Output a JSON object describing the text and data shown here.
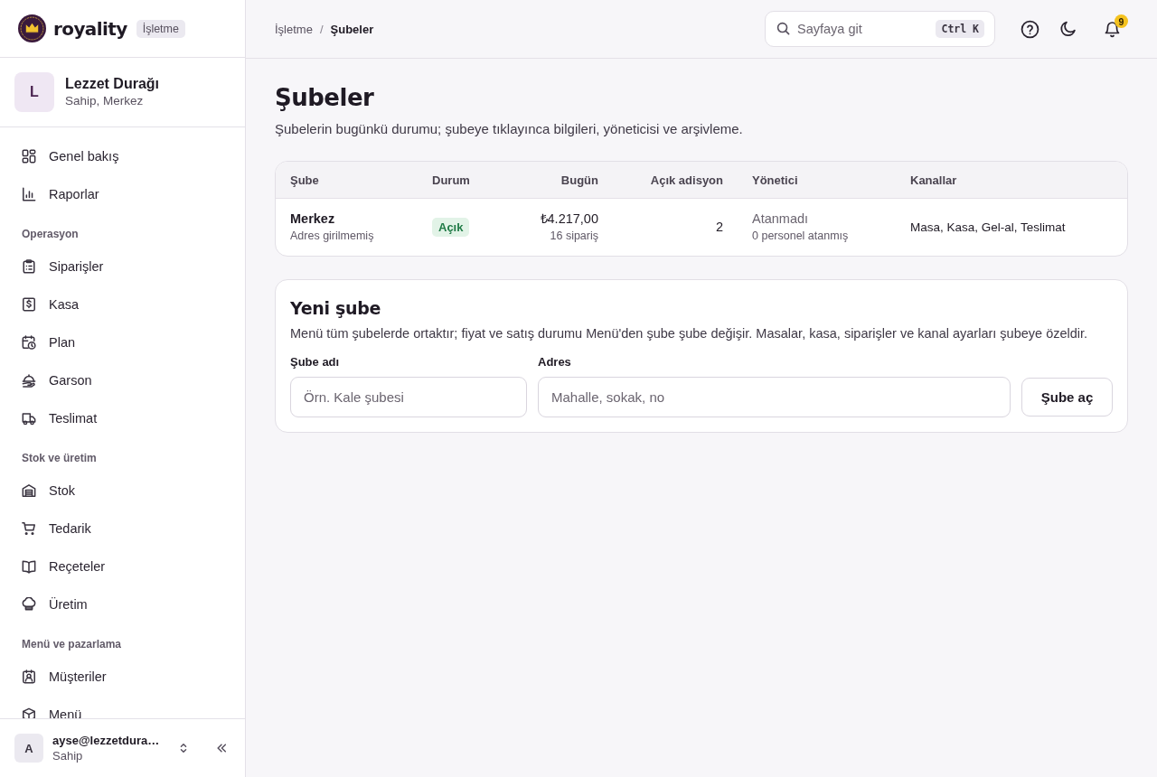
{
  "brand": {
    "name": "royality",
    "badge": "İşletme"
  },
  "business": {
    "initial": "L",
    "name": "Lezzet Durağı",
    "subtitle": "Sahip, Merkez"
  },
  "sidebar": {
    "sections": [
      {
        "items": [
          {
            "label": "Genel bakış",
            "selected": false
          },
          {
            "label": "Raporlar",
            "selected": false
          }
        ]
      },
      {
        "title": "Operasyon",
        "items": [
          {
            "label": "Siparişler",
            "selected": false
          },
          {
            "label": "Kasa",
            "selected": false
          },
          {
            "label": "Plan",
            "selected": false
          },
          {
            "label": "Garson",
            "selected": false
          },
          {
            "label": "Teslimat",
            "selected": false
          }
        ]
      },
      {
        "title": "Stok ve üretim",
        "items": [
          {
            "label": "Stok",
            "selected": false
          },
          {
            "label": "Tedarik",
            "selected": false
          },
          {
            "label": "Reçeteler",
            "selected": false
          },
          {
            "label": "Üretim",
            "selected": false
          }
        ]
      },
      {
        "title": "Menü ve pazarlama",
        "items": [
          {
            "label": "Müşteriler",
            "selected": false
          },
          {
            "label": "Menü",
            "selected": false
          }
        ]
      }
    ]
  },
  "user": {
    "initial": "A",
    "email": "ayse@lezzetdura…",
    "role": "Sahip"
  },
  "breadcrumb": {
    "items": [
      "İşletme",
      "Şubeler"
    ],
    "separator": "/"
  },
  "search": {
    "placeholder": "Sayfaya git",
    "shortcut": "Ctrl K"
  },
  "notifications": {
    "count": "9"
  },
  "page": {
    "title": "Şubeler",
    "subtitle": "Şubelerin bugünkü durumu; şubeye tıklayınca bilgileri, yöneticisi ve arşivleme."
  },
  "table": {
    "columns": [
      {
        "label": "Şube",
        "kind": "text"
      },
      {
        "label": "Durum",
        "kind": "text"
      },
      {
        "label": "Bugün",
        "kind": "number"
      },
      {
        "label": "Açık adisyon",
        "kind": "number"
      },
      {
        "label": "Yönetici",
        "kind": "text"
      },
      {
        "label": "Kanallar",
        "kind": "text"
      }
    ],
    "rows": [
      {
        "cells": [
          {
            "kind": "name",
            "text": "Merkez",
            "sub": "Adres girilmemiş"
          },
          {
            "kind": "status",
            "text": "Açık",
            "open": true
          },
          {
            "kind": "amount",
            "text": "₺4.217,00",
            "sub": "16 sipariş"
          },
          {
            "kind": "number",
            "text": "2"
          },
          {
            "kind": "manager",
            "text": "Atanmadı",
            "sub": "0 personel atanmış",
            "assigned": false
          },
          {
            "kind": "text",
            "text": "Masa, Kasa, Gel-al, Teslimat"
          }
        ]
      }
    ]
  },
  "form": {
    "title": "Yeni şube",
    "description": "Menü tüm şubelerde ortaktır; fiyat ve satış durumu Menü'den şube şube değişir. Masalar, kasa, siparişler ve kanal ayarları şubeye özeldir.",
    "fields": [
      {
        "label": "Şube adı",
        "placeholder": "Örn. Kale şubesi"
      },
      {
        "label": "Adres",
        "placeholder": "Mahalle, sokak, no"
      }
    ],
    "submit": "Şube aç"
  }
}
